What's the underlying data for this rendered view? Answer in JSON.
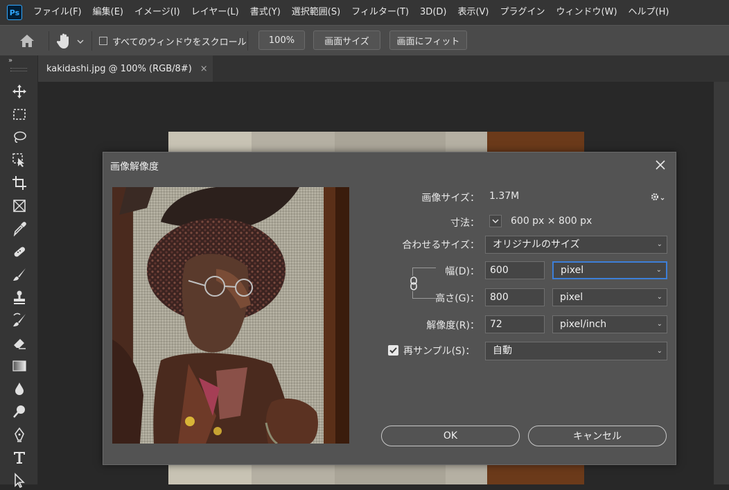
{
  "app": {
    "logo_text": "Ps"
  },
  "menu": [
    "ファイル(F)",
    "編集(E)",
    "イメージ(I)",
    "レイヤー(L)",
    "書式(Y)",
    "選択範囲(S)",
    "フィルター(T)",
    "3D(D)",
    "表示(V)",
    "プラグイン",
    "ウィンドウ(W)",
    "ヘルプ(H)"
  ],
  "options": {
    "scroll_all_label": "すべてのウィンドウをスクロール",
    "zoom_value": "100%",
    "fit_screen_label": "画面サイズ",
    "fill_screen_label": "画面にフィット"
  },
  "document": {
    "tab_title": "kakidashi.jpg @ 100% (RGB/8#)",
    "close_glyph": "×"
  },
  "dialog": {
    "title": "画像解像度",
    "image_size_label": "画像サイズ：",
    "image_size_value": "1.37M",
    "dimensions_label": "寸法：",
    "dimensions_value": "600 px × 800 px",
    "fit_to_label": "合わせるサイズ：",
    "fit_to_value": "オリジナルのサイズ",
    "width_label": "幅(D)：",
    "width_value": "600",
    "width_unit": "pixel",
    "height_label": "高さ(G)：",
    "height_value": "800",
    "height_unit": "pixel",
    "resolution_label": "解像度(R)：",
    "resolution_value": "72",
    "resolution_unit": "pixel/inch",
    "resample_label": "再サンプル(S)：",
    "resample_checked": true,
    "resample_value": "自動",
    "ok_label": "OK",
    "cancel_label": "キャンセル"
  },
  "colors": {
    "accent_focus": "#3d7fd8",
    "menubar": "#353535",
    "dialog_bg": "#535353"
  }
}
